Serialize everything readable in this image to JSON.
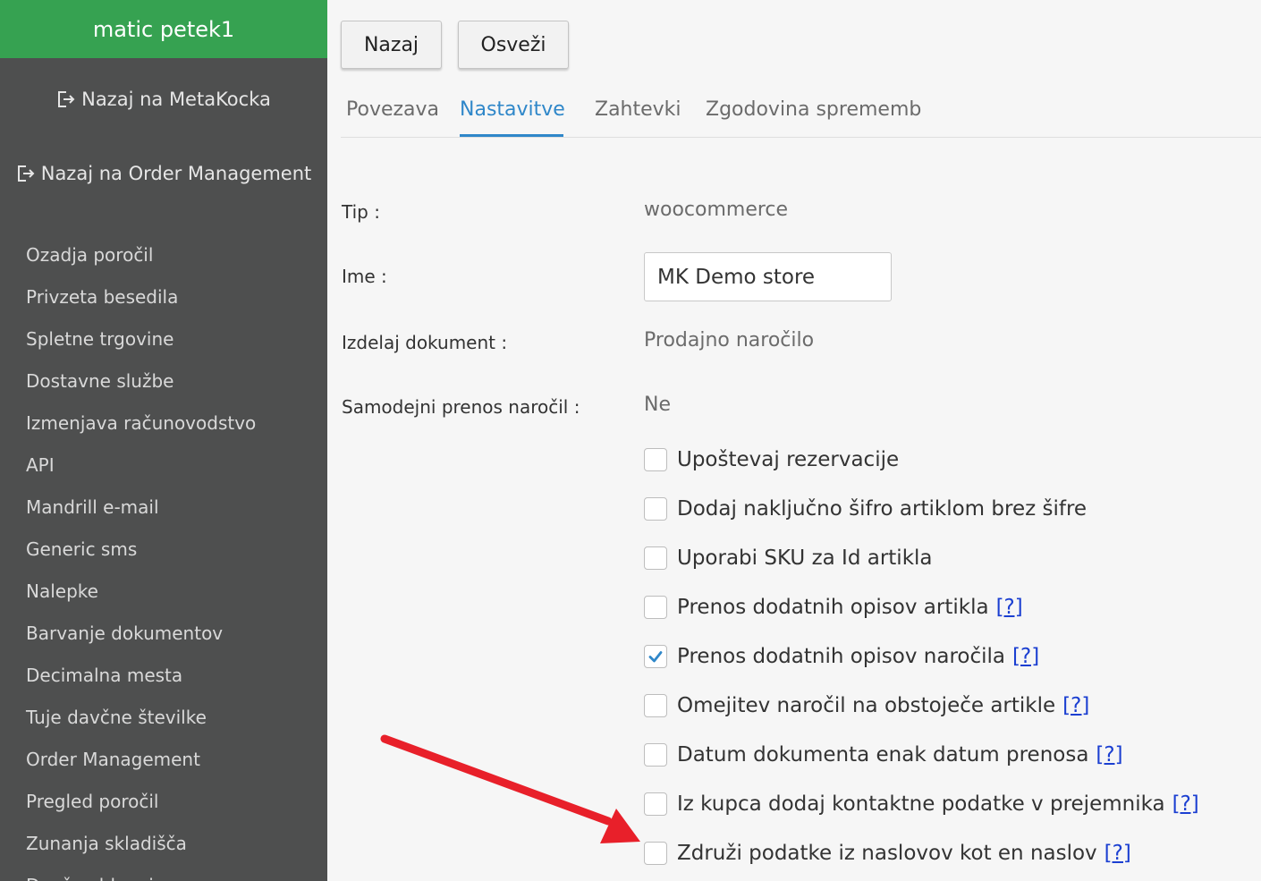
{
  "sidebar": {
    "user": "matic petek1",
    "back_metakocka": "Nazaj na MetaKocka",
    "back_order_mgmt": "Nazaj na Order Management",
    "items": [
      {
        "label": "Ozadja poročil"
      },
      {
        "label": "Privzeta besedila"
      },
      {
        "label": "Spletne trgovine"
      },
      {
        "label": "Dostavne službe"
      },
      {
        "label": "Izmenjava računovodstvo"
      },
      {
        "label": "API"
      },
      {
        "label": "Mandrill e-mail"
      },
      {
        "label": "Generic sms"
      },
      {
        "label": "Nalepke"
      },
      {
        "label": "Barvanje dokumentov"
      },
      {
        "label": "Decimalna mesta"
      },
      {
        "label": "Tuje davčne številke"
      },
      {
        "label": "Order Management"
      },
      {
        "label": "Pregled poročil"
      },
      {
        "label": "Zunanja skladišča"
      },
      {
        "label": "Davčno blagajno"
      }
    ],
    "colors": {
      "user_bar": "#36a251",
      "background": "#4e4f4f"
    }
  },
  "toolbar": {
    "back_label": "Nazaj",
    "refresh_label": "Osveži"
  },
  "tabs": [
    {
      "label": "Povezava",
      "active": false
    },
    {
      "label": "Nastavitve",
      "active": true
    },
    {
      "label": "Zahtevki",
      "active": false
    },
    {
      "label": "Zgodovina sprememb",
      "active": false
    }
  ],
  "form": {
    "type_label": "Tip :",
    "type_value": "woocommerce",
    "name_label": "Ime :",
    "name_value": "MK Demo store",
    "doc_label": "Izdelaj dokument :",
    "doc_value": "Prodajno naročilo",
    "auto_label": "Samodejni prenos naročil :",
    "auto_value": "Ne"
  },
  "options": [
    {
      "label": "Upoštevaj rezervacije",
      "checked": false,
      "help": ""
    },
    {
      "label": "Dodaj naključno šifro artiklom brez šifre",
      "checked": false,
      "help": ""
    },
    {
      "label": "Uporabi SKU za Id artikla",
      "checked": false,
      "help": ""
    },
    {
      "label": "Prenos dodatnih opisov artikla",
      "checked": false,
      "help": "[?]"
    },
    {
      "label": "Prenos dodatnih opisov naročila",
      "checked": true,
      "help": "[?]"
    },
    {
      "label": "Omejitev naročil na obstoječe artikle",
      "checked": false,
      "help": "[?]"
    },
    {
      "label": "Datum dokumenta enak datum prenosa",
      "checked": false,
      "help": "[?]"
    },
    {
      "label": "Iz kupca dodaj kontaktne podatke v prejemnika",
      "checked": false,
      "help": "[?]"
    },
    {
      "label": "Združi podatke iz naslovov kot en naslov",
      "checked": false,
      "help": "[?]"
    }
  ],
  "accent_color": "#2f87c9",
  "annotation_color": "#e8202a"
}
